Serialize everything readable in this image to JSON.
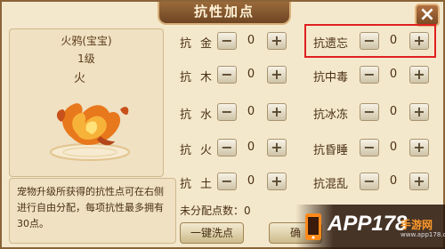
{
  "window": {
    "title": "抗性加点",
    "close_label": "×"
  },
  "pet": {
    "name": "火鸦(宝宝)",
    "level": "1级",
    "element": "火",
    "art_icon": "fire-bird"
  },
  "description": "宠物升级所获得的抗性点可在右侧进行自由分配，每项抗性最多拥有30点。",
  "stats_left": [
    {
      "label": "抗金",
      "value": "0"
    },
    {
      "label": "抗木",
      "value": "0"
    },
    {
      "label": "抗水",
      "value": "0"
    },
    {
      "label": "抗火",
      "value": "0"
    },
    {
      "label": "抗土",
      "value": "0"
    }
  ],
  "stats_right": [
    {
      "label": "抗遗忘",
      "value": "0"
    },
    {
      "label": "抗中毒",
      "value": "0"
    },
    {
      "label": "抗冰冻",
      "value": "0"
    },
    {
      "label": "抗昏睡",
      "value": "0"
    },
    {
      "label": "抗混乱",
      "value": "0"
    }
  ],
  "controls": {
    "minus": "−",
    "plus": "+"
  },
  "unallocated": {
    "text": "未分配点数：0"
  },
  "buttons": {
    "reset": "一键洗点",
    "confirm": "确"
  },
  "watermark": {
    "main": "APP178",
    "sub": "手游网",
    "url": "www.app178.com"
  },
  "colors": {
    "panel": "#f4e8cc",
    "border": "#8a6438",
    "highlight": "#e02020"
  }
}
